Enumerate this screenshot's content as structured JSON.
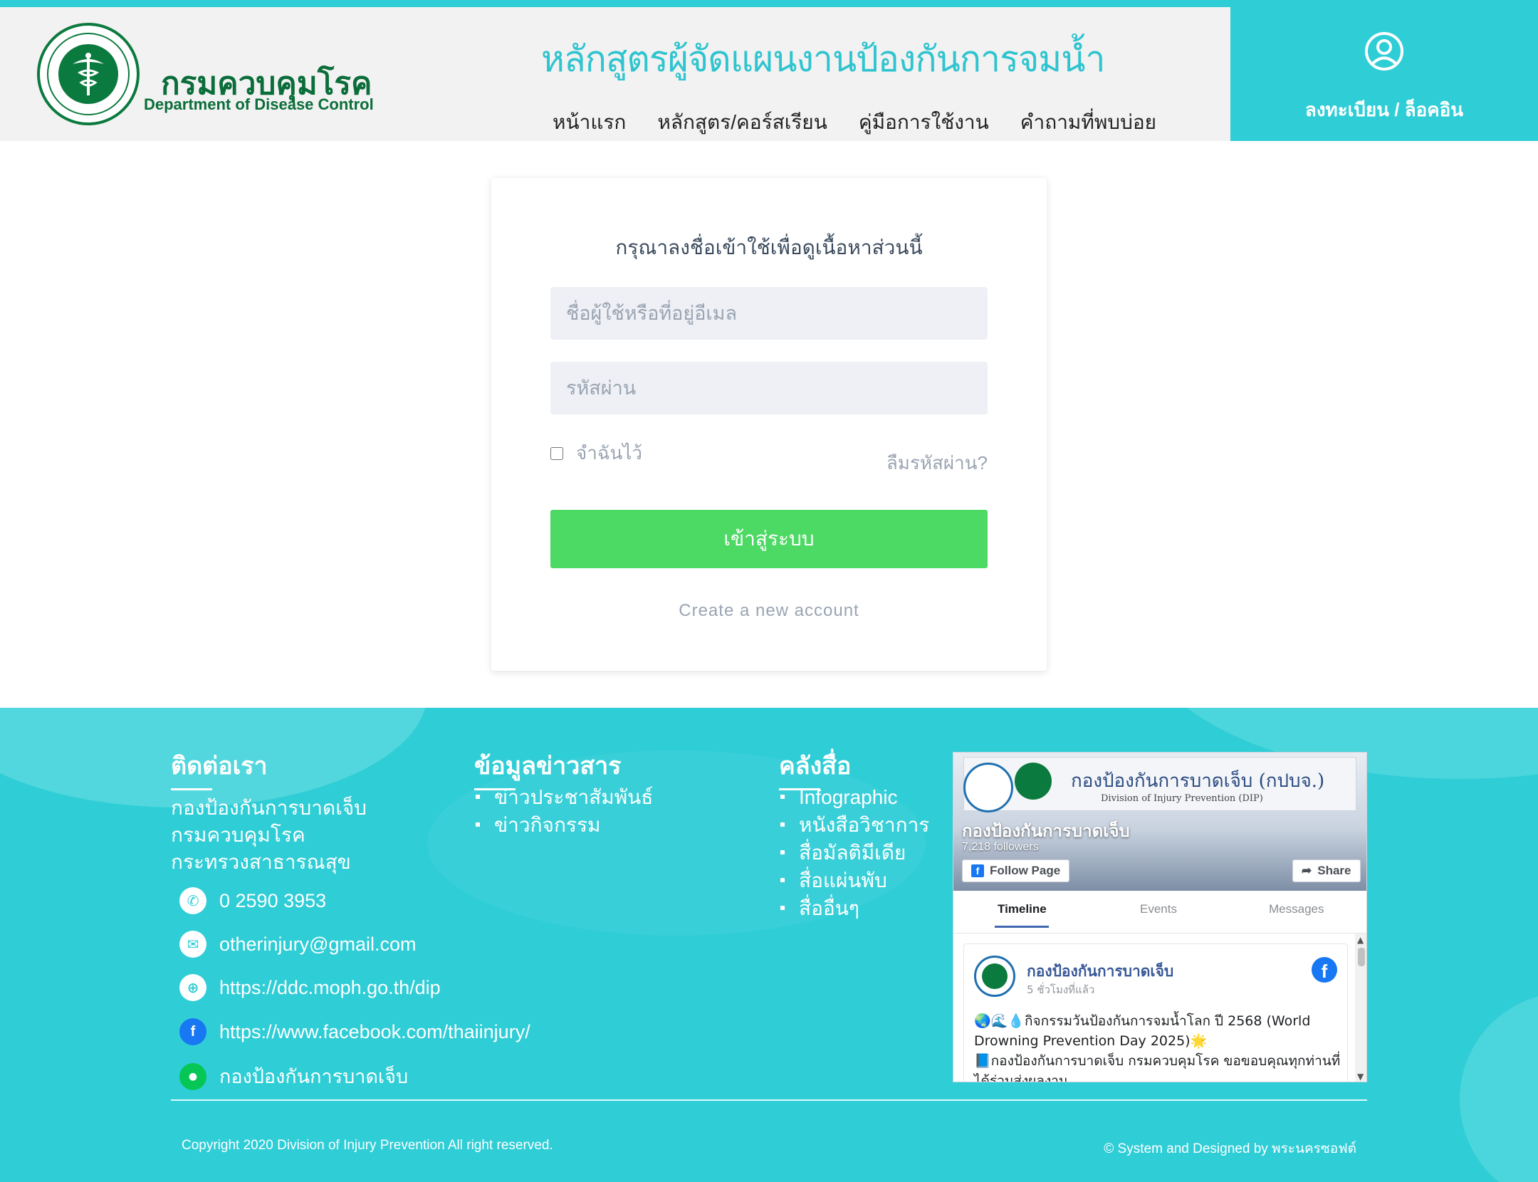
{
  "header": {
    "org_name_th": "กรมควบคุมโรค",
    "org_name_en": "Department of Disease Control",
    "logo_icon": "ministry-of-public-health-seal",
    "site_title": "หลักสูตรผู้จัดแผนงานป้องกันการจมน้ำ",
    "nav": [
      "หน้าแรก",
      "หลักสูตร/คอร์สเรียน",
      "คู่มือการใช้งาน",
      "คำถามที่พบบ่อย"
    ],
    "account_icon": "user-circle-icon",
    "account_link": "ลงทะเบียน / ล็อคอิน"
  },
  "login": {
    "title": "กรุณาลงชื่อเข้าใช้เพื่อดูเนื้อหาส่วนนี้",
    "username_placeholder": "ชื่อผู้ใช้หรือที่อยู่อีเมล",
    "username_value": "",
    "password_placeholder": "รหัสผ่าน",
    "password_value": "",
    "remember_label": "จำฉันไว้",
    "remember_checked": false,
    "forgot_label": "ลืมรหัสผ่าน?",
    "submit_label": "เข้าสู่ระบบ",
    "create_account_label": "Create a new account"
  },
  "footer": {
    "contact": {
      "title": "ติดต่อเรา",
      "address": [
        "กองป้องกันการบาดเจ็บ",
        "กรมควบคุมโรค",
        "กระทรวงสาธารณสุข"
      ],
      "phone": "0 2590 3953",
      "email": "otherinjury@gmail.com",
      "website": "https://ddc.moph.go.th/dip",
      "facebook": "https://www.facebook.com/thaiinjury/",
      "line": "กองป้องกันการบาดเจ็บ"
    },
    "news": {
      "title": "ข้อมูลข่าวสาร",
      "items": [
        "ข่าวประชาสัมพันธ์",
        "ข่าวกิจกรรม"
      ]
    },
    "media": {
      "title": "คลังสื่อ",
      "items": [
        "Infographic",
        "หนังสือวิชาการ",
        "สื่อมัลติมีเดีย",
        "สื่อแผ่นพับ",
        "สื่ออื่นๆ"
      ]
    },
    "facebook_widget": {
      "cover_title": "กองป้องกันการบาดเจ็บ (กปบจ.)",
      "cover_subtitle": "Division of Injury Prevention (DIP)",
      "page_name": "กองป้องกันการบาดเจ็บ",
      "followers": "7,218 followers",
      "follow_label": "Follow Page",
      "share_label": "Share",
      "tabs": [
        "Timeline",
        "Events",
        "Messages"
      ],
      "post": {
        "author": "กองป้องกันการบาดเจ็บ",
        "time": "5 ชั่วโมงที่แล้ว",
        "text_line1": "🌏🌊💧กิจกรรมวันป้องกันการจมน้ำโลก ปี 2568 (World Drowning Prevention Day 2025)🌟",
        "text_line2": "📘กองป้องกันการบาดเจ็บ กรมควบคุมโรค ขอขอบคุณทุกท่านที่ได้ร่วมส่งผลงาน"
      }
    },
    "copyright": "Copyright 2020 Division of Injury Prevention All right reserved.",
    "designed_by": "© System and Designed by พระนครซอฟต์"
  },
  "colors": {
    "accent": "#2fcdd6",
    "brand_green": "#0b6d3a",
    "login_button": "#4cd964"
  }
}
